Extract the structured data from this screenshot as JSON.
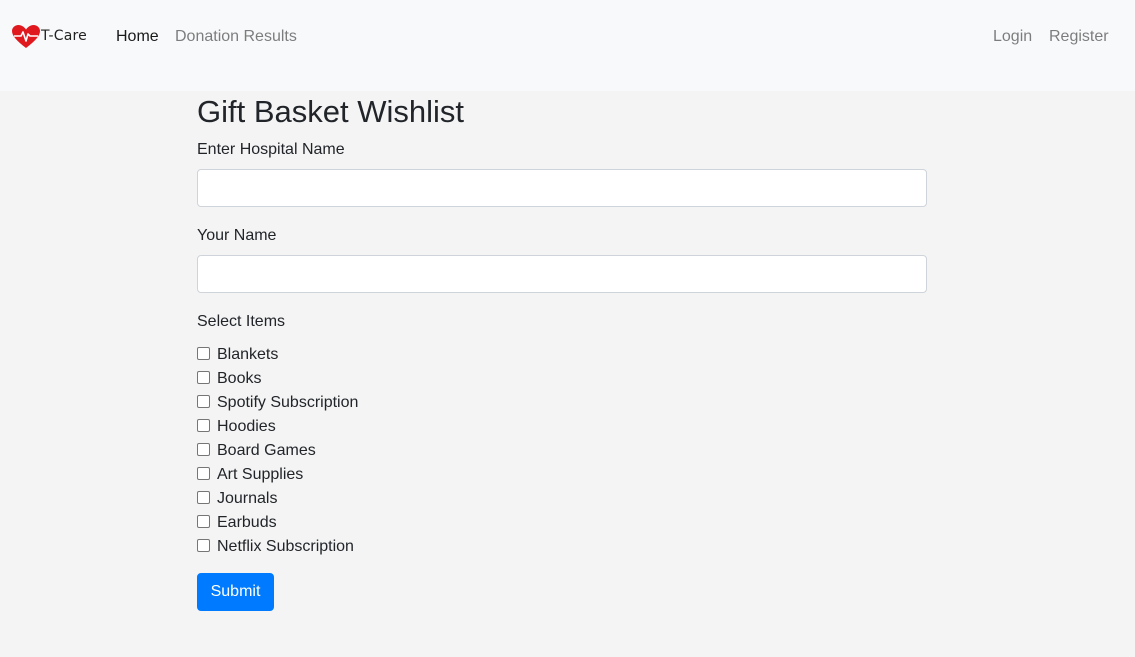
{
  "navbar": {
    "brand_text": "T-Care",
    "brand_icon": "heart-pulse-icon",
    "links": [
      {
        "label": "Home",
        "active": true
      },
      {
        "label": "Donation Results",
        "active": false
      }
    ],
    "right_links": [
      {
        "label": "Login"
      },
      {
        "label": "Register"
      }
    ]
  },
  "form": {
    "title": "Gift Basket Wishlist",
    "hospital_label": "Enter Hospital Name",
    "hospital_value": "",
    "name_label": "Your Name",
    "name_value": "",
    "items_label": "Select Items",
    "items": [
      {
        "label": "Blankets",
        "checked": false
      },
      {
        "label": "Books",
        "checked": false
      },
      {
        "label": "Spotify Subscription",
        "checked": false
      },
      {
        "label": "Hoodies",
        "checked": false
      },
      {
        "label": "Board Games",
        "checked": false
      },
      {
        "label": "Art Supplies",
        "checked": false
      },
      {
        "label": "Journals",
        "checked": false
      },
      {
        "label": "Earbuds",
        "checked": false
      },
      {
        "label": "Netflix Subscription",
        "checked": false
      }
    ],
    "submit_label": "Submit"
  },
  "colors": {
    "navbar_bg": "#f8f9fa",
    "page_bg": "#f4f4f4",
    "primary": "#007bff",
    "brand_heart": "#e0191f"
  }
}
